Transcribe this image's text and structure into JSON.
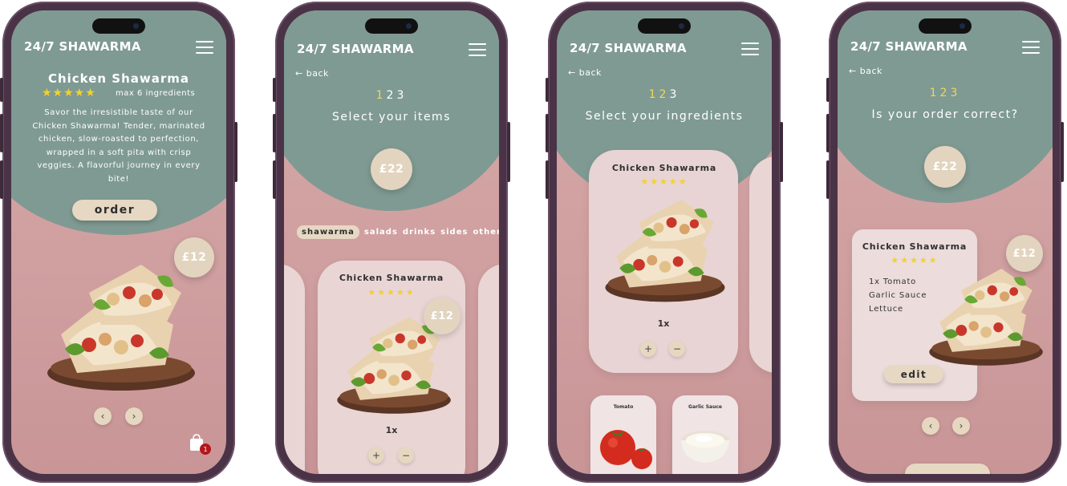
{
  "brand": "24/7 SHAWARMA",
  "screen1": {
    "title": "Chicken Shawarma",
    "stars": "★★★★★",
    "max_note": "max 6 ingredients",
    "description": "Savor the irresistible taste of our Chicken Shawarma! Tender, marinated chicken, slow-roasted to perfection, wrapped in a soft pita with crisp veggies. A flavorful journey in every bite!",
    "order_label": "order",
    "price": "£12",
    "prev": "‹",
    "next": "›",
    "cart_badge": "1"
  },
  "screen2": {
    "back_label": "back",
    "steps": [
      "1",
      "2",
      "3"
    ],
    "active_step": 1,
    "heading": "Select your items",
    "total": "£22",
    "categories": [
      "shawarma",
      "salads",
      "drinks",
      "sides",
      "other"
    ],
    "active_category": "shawarma",
    "card_title": "Chicken Shawarma",
    "stars": "★★★★★",
    "price": "£12",
    "qty": "1x",
    "plus": "+",
    "minus": "−"
  },
  "screen3": {
    "back_label": "back",
    "steps": [
      "1",
      "2",
      "3"
    ],
    "active_step": 2,
    "heading": "Select your ingredients",
    "card_title": "Chicken Shawarma",
    "stars": "★★★★★",
    "qty": "1x",
    "plus": "+",
    "minus": "−",
    "ingredients": [
      "Tomato",
      "Garlic Sauce"
    ]
  },
  "screen4": {
    "back_label": "back",
    "steps": [
      "1",
      "2",
      "3"
    ],
    "active_step": 3,
    "heading": "Is your order correct?",
    "total": "£22",
    "card_title": "Chicken Shawarma",
    "stars": "★★★★★",
    "items": [
      "1x Tomato",
      "Garlic Sauce",
      "Lettuce"
    ],
    "price": "£12",
    "edit_label": "edit",
    "prev": "‹",
    "next": "›"
  },
  "colors": {
    "teal": "#7f9a93",
    "pink": "#d4a5a6",
    "cream": "#e6d8c3",
    "star": "#f2d22b"
  }
}
